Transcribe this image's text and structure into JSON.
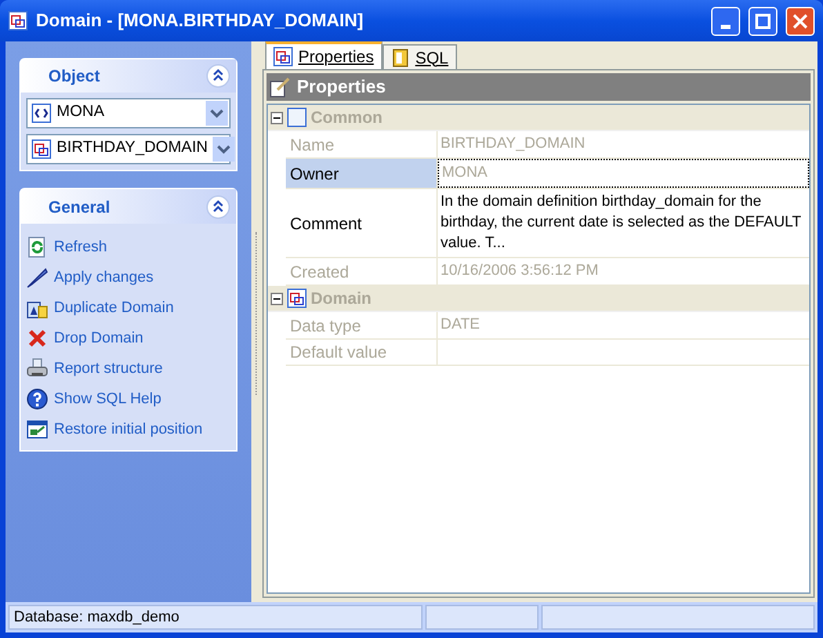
{
  "window": {
    "title": "Domain - [MONA.BIRTHDAY_DOMAIN]"
  },
  "object_panel": {
    "title": "Object",
    "expanded": true,
    "combos": [
      {
        "value": "MONA",
        "kind": "schema"
      },
      {
        "value": "BIRTHDAY_DOMAIN",
        "kind": "domain"
      }
    ]
  },
  "general_panel": {
    "title": "General",
    "expanded": true,
    "items": [
      {
        "label": "Refresh",
        "kind": "refresh"
      },
      {
        "label": "Apply changes",
        "kind": "apply"
      },
      {
        "label": "Duplicate Domain",
        "kind": "duplicate"
      },
      {
        "label": "Drop Domain",
        "kind": "drop"
      },
      {
        "label": "Report structure",
        "kind": "report"
      },
      {
        "label": "Show SQL Help",
        "kind": "help"
      },
      {
        "label": "Restore initial position",
        "kind": "restore"
      }
    ]
  },
  "tabs": [
    {
      "label": "Properties",
      "selected": true,
      "kind": "properties"
    },
    {
      "label": "SQL",
      "selected": false,
      "kind": "sql"
    }
  ],
  "properties": {
    "title": "Properties",
    "groups": [
      {
        "label": "Common",
        "expanded": true,
        "kind": "common",
        "rows": [
          {
            "name": "Name",
            "value": "BIRTHDAY_DOMAIN",
            "disabled": true,
            "selected": false
          },
          {
            "name": "Owner",
            "value": "MONA",
            "disabled": false,
            "selected": true
          },
          {
            "name": "Comment",
            "value": "In the domain definition birthday_domain for the birthday, the current date is selected as the DEFAULT value. T...",
            "disabled": false,
            "selected": false
          },
          {
            "name": "Created",
            "value": "10/16/2006 3:56:12 PM",
            "disabled": true,
            "selected": false
          }
        ]
      },
      {
        "label": "Domain",
        "expanded": true,
        "kind": "domain",
        "rows": [
          {
            "name": "Data type",
            "value": "DATE",
            "disabled": true,
            "selected": false
          },
          {
            "name": "Default value",
            "disabled": true,
            "selected": false
          }
        ]
      }
    ]
  },
  "status_bar": {
    "text": "Database: maxdb_demo"
  }
}
